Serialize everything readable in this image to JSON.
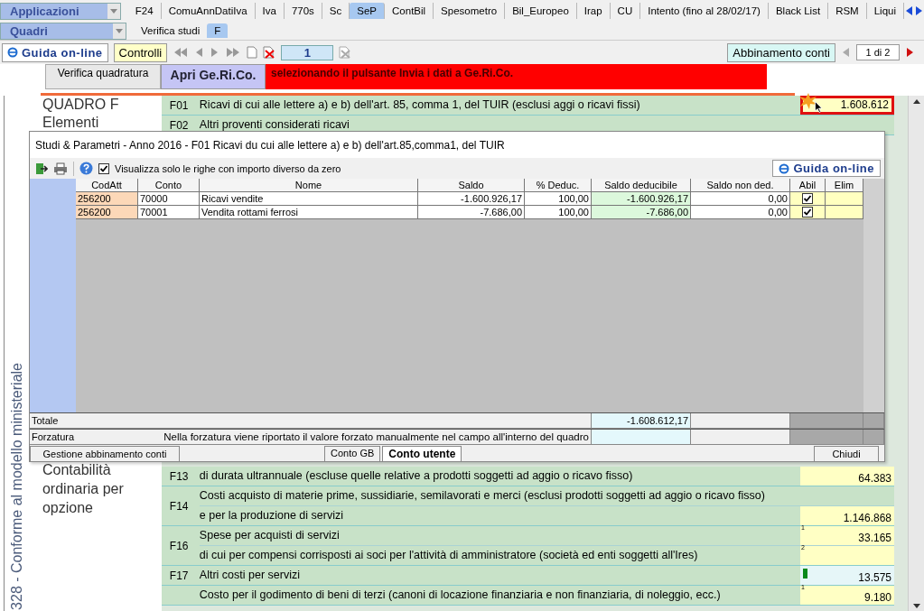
{
  "app_bar": {
    "selector": "Applicazioni",
    "tabs": [
      {
        "label": "F24",
        "selected": false
      },
      {
        "label": "ComuAnnDatiIva",
        "selected": false
      },
      {
        "label": "Iva",
        "selected": false
      },
      {
        "label": "770s",
        "selected": false
      },
      {
        "label": "Sc",
        "selected": false
      },
      {
        "label": "SeP",
        "selected": true
      },
      {
        "label": "ContBil",
        "selected": false
      },
      {
        "label": "Spesometro",
        "selected": false
      },
      {
        "label": "Bil_Europeo",
        "selected": false
      },
      {
        "label": "Irap",
        "selected": false
      },
      {
        "label": "CU",
        "selected": false
      },
      {
        "label": "Intento (fino al 28/02/17)",
        "selected": false
      },
      {
        "label": "Black List",
        "selected": false
      },
      {
        "label": "RSM",
        "selected": false
      },
      {
        "label": "Liqui",
        "selected": false
      }
    ]
  },
  "sub_bar": {
    "selector": "Quadri",
    "tabs": [
      {
        "label": "Verifica studi",
        "selected": false
      },
      {
        "label": "F",
        "selected": true
      }
    ]
  },
  "toolbar": {
    "help": "Guida on-line",
    "controls": "Controlli",
    "page": "1",
    "link": "Abbinamento conti",
    "pager": "1 di 2"
  },
  "actions": {
    "check": "Verifica quadratura",
    "open": "Apri Ge.Ri.Co.",
    "banner": "selezionando il pulsante Invia i dati a Ge.Ri.Co."
  },
  "side_caption": "328 - Conforme al modello ministeriale",
  "section": {
    "title": "QUADRO F",
    "subtitle": "Elementi",
    "note": "Contabilità ordinaria per opzione"
  },
  "rows_above": [
    {
      "code": "F01",
      "lines": [
        {
          "text": "Ricavi di cui alle lettere a) e b) dell'art. 85, comma 1, del TUIR (esclusi aggi o ricavi fissi)",
          "value": "1.608.612",
          "highlighted": true
        }
      ]
    },
    {
      "code": "F02",
      "lines": [
        {
          "text": "Altri proventi considerati ricavi"
        }
      ]
    }
  ],
  "rows_below": [
    {
      "code": "F13",
      "lines": [
        {
          "text": "di durata ultrannuale (escluse quelle relative a prodotti soggetti ad aggio o ricavo fisso)",
          "value": "64.383"
        }
      ]
    },
    {
      "code": "F14",
      "lines": [
        {
          "text": "Costi acquisto di materie prime, sussidiarie, semilavorati e merci  (esclusi prodotti soggetti ad aggio o ricavo fisso)"
        },
        {
          "text": "e per la produzione di servizi",
          "value": "1.146.868"
        }
      ]
    },
    {
      "code": "F16",
      "lines": [
        {
          "text": "Spese per acquisti di servizi",
          "index": "1",
          "value": "33.165"
        },
        {
          "text": "di cui per compensi corrisposti ai soci per l'attività di amministratore (società ed enti soggetti all'Ires)",
          "index": "2"
        }
      ]
    },
    {
      "code": "F17",
      "lines": [
        {
          "text": "Altri costi per servizi",
          "value": "13.575",
          "flagged": true
        }
      ]
    },
    {
      "lines": [
        {
          "text": "Costo per il godimento di beni di terzi (canoni di locazione finanziaria e non finanziaria, di noleggio, ecc.)",
          "index": "1",
          "value": "9.180"
        }
      ]
    }
  ],
  "dialog": {
    "title": "Studi & Parametri - Anno 2016 - F01  Ricavi du cui alle lettere a) e b) dell'art.85,comma1, del TUIR",
    "filter": {
      "label": "Visualizza solo le righe con importo diverso da zero",
      "checked": true
    },
    "help": "Guida on-line",
    "columns": [
      "CodAtt",
      "Conto",
      "Nome",
      "Saldo",
      "% Deduc.",
      "Saldo deducibile",
      "Saldo non ded.",
      "Abil",
      "Elim"
    ],
    "rows": [
      {
        "codatt": "256200",
        "conto": "70000",
        "nome": "Ricavi vendite",
        "saldo": "-1.600.926,17",
        "deduc": "100,00",
        "saldo_ded": "-1.600.926,17",
        "saldo_non_ded": "0,00",
        "abil": true
      },
      {
        "codatt": "256200",
        "conto": "70001",
        "nome": "Vendita rottami ferrosi",
        "saldo": "-7.686,00",
        "deduc": "100,00",
        "saldo_ded": "-7.686,00",
        "saldo_non_ded": "0,00",
        "abil": true
      }
    ],
    "total_label": "Totale",
    "total": "-1.608.612,17",
    "override_label": "Forzatura",
    "override_note": "Nella forzatura viene riportato il valore forzato manualmente nel campo all'interno del quadro",
    "manage": "Gestione abbinamento conti",
    "tabs": [
      {
        "label": "Conto GB",
        "selected": false
      },
      {
        "label": "Conto utente",
        "selected": true
      }
    ],
    "close": "Chiudi"
  }
}
